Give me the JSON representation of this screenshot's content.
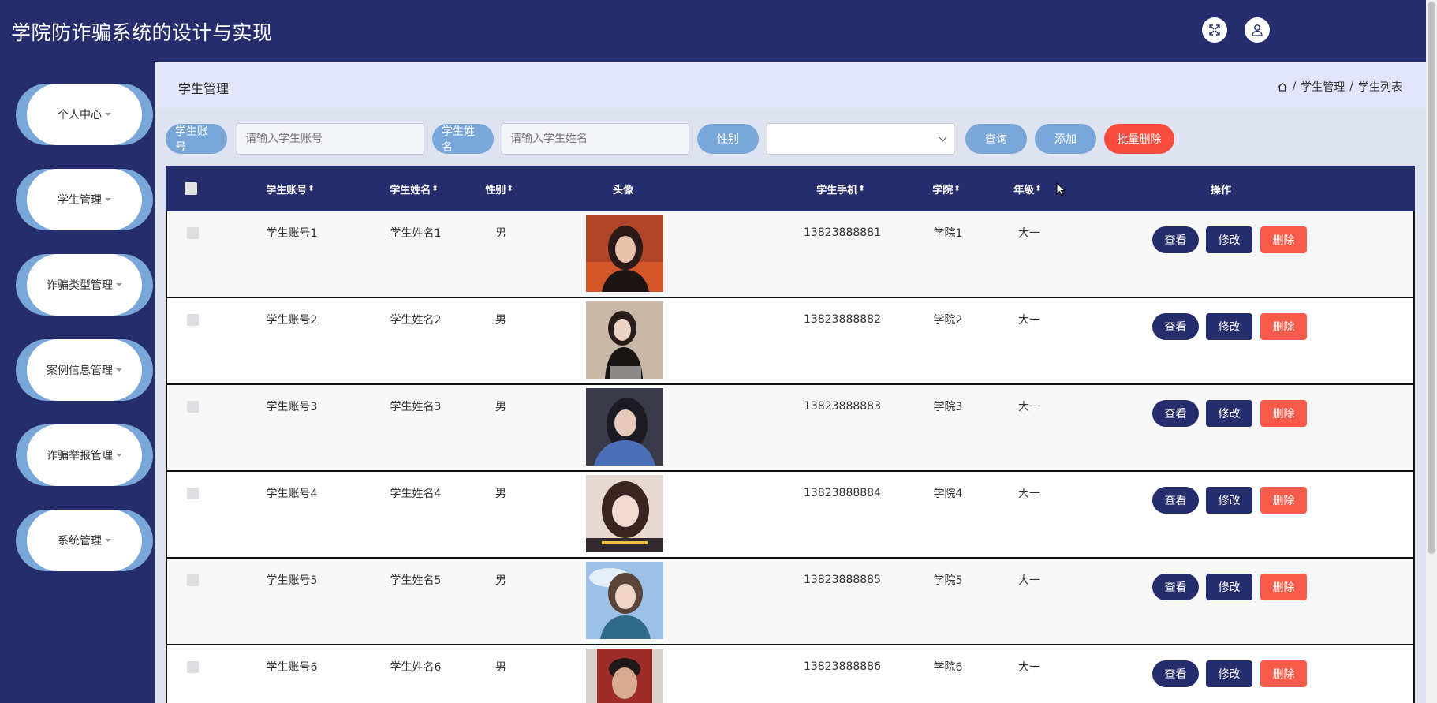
{
  "header": {
    "title": "学院防诈骗系统的设计与实现",
    "fullscreen_icon": "fullscreen-icon",
    "user_icon": "user-icon"
  },
  "sidebar": {
    "items": [
      {
        "label": "个人中心"
      },
      {
        "label": "学生管理"
      },
      {
        "label": "诈骗类型管理"
      },
      {
        "label": "案例信息管理"
      },
      {
        "label": "诈骗举报管理"
      },
      {
        "label": "系统管理"
      }
    ]
  },
  "page": {
    "title": "学生管理",
    "breadcrumb": [
      "学生管理",
      "学生列表"
    ],
    "separator": "/"
  },
  "search": {
    "account_label": "学生账号",
    "account_placeholder": "请输入学生账号",
    "name_label": "学生姓名",
    "name_placeholder": "请输入学生姓名",
    "gender_label": "性别",
    "gender_value": "",
    "query_button": "查询",
    "add_button": "添加",
    "batch_delete_button": "批量删除"
  },
  "table": {
    "headers": {
      "account": "学生账号",
      "name": "学生姓名",
      "gender": "性别",
      "avatar": "头像",
      "phone": "学生手机",
      "college": "学院",
      "grade": "年级",
      "actions": "操作"
    },
    "sort_glyph": "⬍",
    "rows": [
      {
        "account": "学生账号1",
        "name": "学生姓名1",
        "gender": "男",
        "phone": "13823888881",
        "college": "学院1",
        "grade": "大一"
      },
      {
        "account": "学生账号2",
        "name": "学生姓名2",
        "gender": "男",
        "phone": "13823888882",
        "college": "学院2",
        "grade": "大一"
      },
      {
        "account": "学生账号3",
        "name": "学生姓名3",
        "gender": "男",
        "phone": "13823888883",
        "college": "学院3",
        "grade": "大一"
      },
      {
        "account": "学生账号4",
        "name": "学生姓名4",
        "gender": "男",
        "phone": "13823888884",
        "college": "学院4",
        "grade": "大一"
      },
      {
        "account": "学生账号5",
        "name": "学生姓名5",
        "gender": "男",
        "phone": "13823888885",
        "college": "学院5",
        "grade": "大一"
      },
      {
        "account": "学生账号6",
        "name": "学生姓名6",
        "gender": "男",
        "phone": "13823888886",
        "college": "学院6",
        "grade": "大一"
      }
    ],
    "action_labels": {
      "view": "查看",
      "edit": "修改",
      "delete": "删除"
    }
  },
  "colors": {
    "primary": "#262d6c",
    "accent": "#7aa7d9",
    "danger": "#f85a49"
  }
}
